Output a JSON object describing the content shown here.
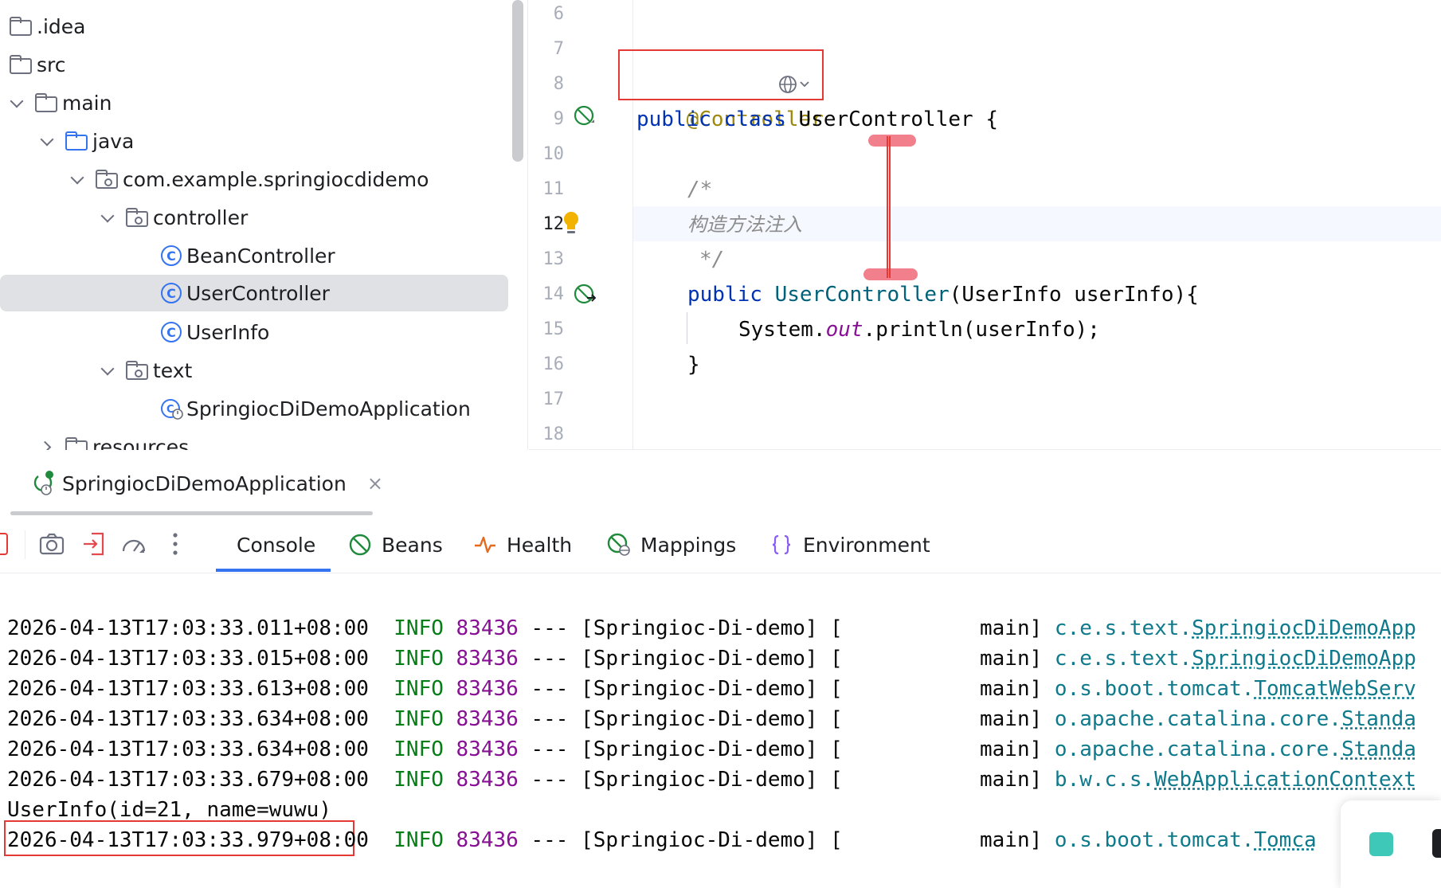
{
  "tree": {
    "items": [
      {
        "label": ".idea",
        "kind": "folder",
        "chevron": "none"
      },
      {
        "label": "src",
        "kind": "folder",
        "chevron": "none"
      },
      {
        "label": "main",
        "kind": "folder",
        "chevron": "down"
      },
      {
        "label": "java",
        "kind": "source-folder",
        "chevron": "down"
      },
      {
        "label": "com.example.springiocdidemo",
        "kind": "package",
        "chevron": "down"
      },
      {
        "label": "controller",
        "kind": "package",
        "chevron": "down"
      },
      {
        "label": "BeanController",
        "kind": "class",
        "chevron": "none"
      },
      {
        "label": "UserController",
        "kind": "class",
        "chevron": "none",
        "selected": true
      },
      {
        "label": "UserInfo",
        "kind": "class",
        "chevron": "none"
      },
      {
        "label": "text",
        "kind": "package",
        "chevron": "down"
      },
      {
        "label": "SpringiocDiDemoApplication",
        "kind": "spring-app",
        "chevron": "none"
      },
      {
        "label": "resources",
        "kind": "folder",
        "chevron": "right"
      }
    ]
  },
  "editor": {
    "line_numbers": [
      "6",
      "7",
      "8",
      "9",
      "10",
      "11",
      "12",
      "13",
      "14",
      "15",
      "16",
      "17",
      "18"
    ],
    "current_line": "12",
    "code": {
      "l8_annotation": "@Controller",
      "l9_public": "public",
      "l9_class": "class",
      "l9_name": "UserController",
      "l9_brace": "{",
      "l11": "/*",
      "l12": "构造方法注入",
      "l13": "*/",
      "l14_public": "public",
      "l14_name": "UserController",
      "l14_params": "(UserInfo userInfo){",
      "l15_system": "System.",
      "l15_out": "out",
      "l15_println": ".println(userInfo);",
      "l16": "}"
    }
  },
  "run": {
    "tab_label": "SpringiocDiDemoApplication",
    "close_glyph": "×",
    "tabs": [
      "Console",
      "Beans",
      "Health",
      "Mappings",
      "Environment"
    ],
    "toolbar_icons": [
      "stop-icon",
      "camera-icon",
      "exit-icon",
      "gauge-icon",
      "more-icon"
    ]
  },
  "console": {
    "lines": [
      {
        "ts": "2026-04-13T17:03:33.011+08:00",
        "level": "INFO",
        "pid": "83436",
        "app": " --- [Springioc-Di-demo] [           main] ",
        "logger_pre": "c.e.s.text.",
        "logger_u": "SpringiocDiDemoApp"
      },
      {
        "ts": "2026-04-13T17:03:33.015+08:00",
        "level": "INFO",
        "pid": "83436",
        "app": " --- [Springioc-Di-demo] [           main] ",
        "logger_pre": "c.e.s.text.",
        "logger_u": "SpringiocDiDemoApp"
      },
      {
        "ts": "2026-04-13T17:03:33.613+08:00",
        "level": "INFO",
        "pid": "83436",
        "app": " --- [Springioc-Di-demo] [           main] ",
        "logger_pre": "o.s.boot.tomcat.",
        "logger_u": "TomcatWebServ"
      },
      {
        "ts": "2026-04-13T17:03:33.634+08:00",
        "level": "INFO",
        "pid": "83436",
        "app": " --- [Springioc-Di-demo] [           main] ",
        "logger_pre": "o.apache.catalina.core.",
        "logger_u": "Standa"
      },
      {
        "ts": "2026-04-13T17:03:33.634+08:00",
        "level": "INFO",
        "pid": "83436",
        "app": " --- [Springioc-Di-demo] [           main] ",
        "logger_pre": "o.apache.catalina.core.",
        "logger_u": "Standa"
      },
      {
        "ts": "2026-04-13T17:03:33.679+08:00",
        "level": "INFO",
        "pid": "83436",
        "app": " --- [Springioc-Di-demo] [           main] ",
        "logger_pre": "b.w.c.s.",
        "logger_u": "WebApplicationContext"
      },
      {
        "plain": "UserInfo(id=21, name=wuwu)"
      },
      {
        "ts": "2026-04-13T17:03:33.979+08:00",
        "level": "INFO",
        "pid": "83436",
        "app": " --- [Springioc-Di-demo] [           main] ",
        "logger_pre": "o.s.boot.tomcat.",
        "logger_u": "Tomca"
      }
    ]
  },
  "colors": {
    "keyword": "#0033b3",
    "annotation": "#9e880d",
    "method": "#00627a",
    "static_field": "#871094",
    "comment": "#8c8c8c",
    "info_level": "#067d17",
    "pid": "#871094",
    "logger": "#0f7a8c",
    "highlight_box": "#e53935",
    "accent": "#3574f0"
  }
}
